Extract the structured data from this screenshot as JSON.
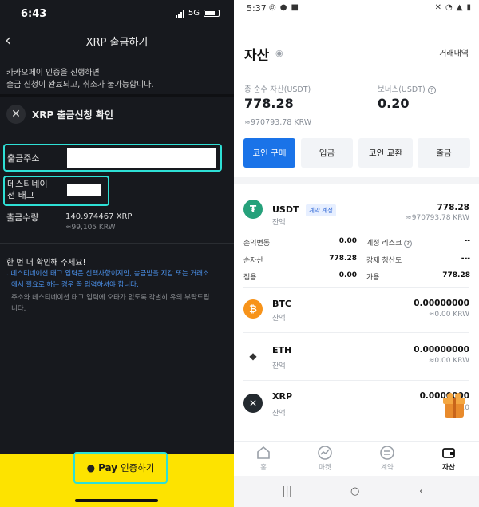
{
  "left": {
    "status": {
      "time": "6:43",
      "network": "5G"
    },
    "header": {
      "back_icon": "chevron-left-icon",
      "title": "XRP 출금하기"
    },
    "notice": {
      "line1": "카카오페이 인증을 진행하면",
      "line2": "출금 신청이 완료되고, 취소가 불가능합니다."
    },
    "confirm_title": "XRP 출금신청 확인",
    "rows": {
      "address_label": "출금주소",
      "tag_label_1": "데스티네이",
      "tag_label_2": "션 태그",
      "amount_label": "출금수량",
      "amount_value": "140.974467 XRP",
      "amount_krw": "≈99,105 KRW"
    },
    "check": {
      "title": "한 번 더 확인해 주세요!",
      "blue1": "데스티네이션 태그 입력은 선택사항이지만, 송금받을 지갑 또는 거래소",
      "blue2": "에서 필요로 하는 경우 꼭 입력하셔야 합니다.",
      "gray1": "주소와 데스티네이션 태그 입력에 오타가 없도록 각별히 유의 부탁드립",
      "gray2": "니다."
    },
    "pay": {
      "bold": "Pay",
      "text": "인증하기"
    },
    "colors": {
      "highlight": "#2ee0d6",
      "pay_bar": "#fde300"
    }
  },
  "right": {
    "status": {
      "time": "5:37"
    },
    "title": "자산",
    "history": "거래내역",
    "total_label": "총 순수 자산(USDT)",
    "total_value": "778.28",
    "total_krw": "≈970793.78 KRW",
    "bonus_label": "보너스(USDT)",
    "bonus_value": "0.20",
    "buttons": [
      "코인 구매",
      "입금",
      "코인 교환",
      "출금"
    ],
    "usdt": {
      "name": "USDT",
      "sub": "잔액",
      "badge": "계약 계정",
      "value": "778.28",
      "krw": "≈970793.78 KRW",
      "stats": [
        {
          "label": "손익변동",
          "value": "0.00"
        },
        {
          "label": "계정 리스크",
          "value": "--"
        },
        {
          "label": "순자산",
          "value": "778.28"
        },
        {
          "label": "강제 청산도",
          "value": "---"
        },
        {
          "label": "점용",
          "value": "0.00"
        },
        {
          "label": "가용",
          "value": "778.28"
        }
      ]
    },
    "coins": [
      {
        "name": "BTC",
        "sub": "잔액",
        "value": "0.00000000",
        "krw": "≈0.00 KRW",
        "color": "#f7931a"
      },
      {
        "name": "ETH",
        "sub": "잔액",
        "value": "0.00000000",
        "krw": "≈0.00 KRW",
        "color": "#ffffff"
      },
      {
        "name": "XRP",
        "sub": "잔액",
        "value": "0.0000000",
        "krw": "≈0.0",
        "color": "#23292f"
      }
    ],
    "nav": [
      {
        "label": "홈",
        "icon": "home-icon"
      },
      {
        "label": "마켓",
        "icon": "market-icon"
      },
      {
        "label": "계약",
        "icon": "contract-icon"
      },
      {
        "label": "자산",
        "icon": "wallet-icon"
      }
    ],
    "colors": {
      "primary": "#1a73e8",
      "usdt": "#26a17b"
    }
  }
}
